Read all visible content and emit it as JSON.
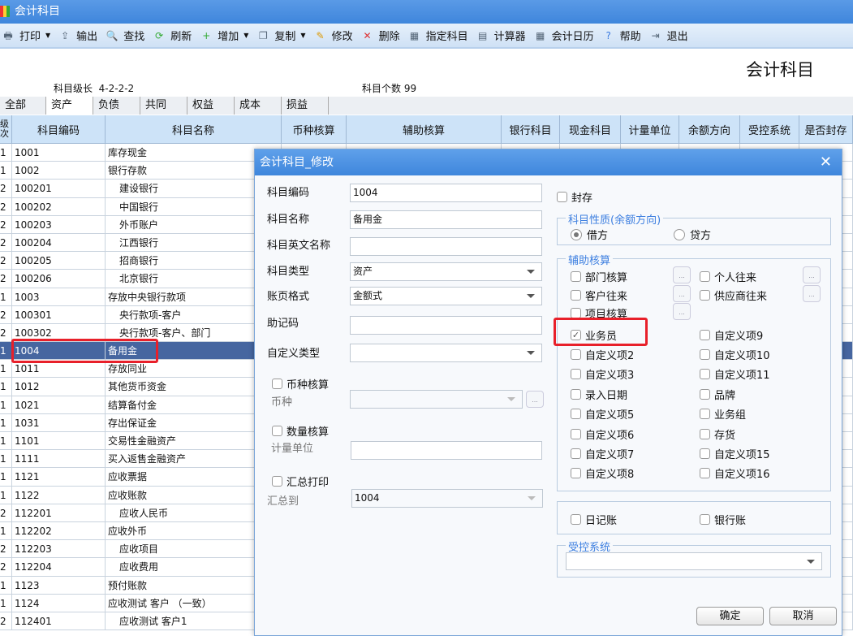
{
  "window": {
    "title": "会计科目"
  },
  "toolbar": [
    {
      "label": "打印",
      "icon": "printer-icon",
      "dropdown": true
    },
    {
      "label": "输出",
      "icon": "export-icon"
    },
    {
      "label": "查找",
      "icon": "search-icon"
    },
    {
      "label": "刷新",
      "icon": "refresh-icon"
    },
    {
      "label": "增加",
      "icon": "add-icon",
      "dropdown": true
    },
    {
      "label": "复制",
      "icon": "copy-icon",
      "dropdown": true
    },
    {
      "label": "修改",
      "icon": "edit-icon"
    },
    {
      "label": "删除",
      "icon": "delete-icon"
    },
    {
      "label": "指定科目",
      "icon": "assign-icon"
    },
    {
      "label": "计算器",
      "icon": "calculator-icon"
    },
    {
      "label": "会计日历",
      "icon": "calendar-icon"
    },
    {
      "label": "帮助",
      "icon": "help-icon"
    },
    {
      "label": "退出",
      "icon": "exit-icon"
    }
  ],
  "page": {
    "title": "会计科目",
    "level_label": "科目级长",
    "level_value": "4-2-2-2",
    "count_label": "科目个数",
    "count_value": "99"
  },
  "tabs": [
    "全部",
    "资产",
    "负债",
    "共同",
    "权益",
    "成本",
    "损益"
  ],
  "active_tab": "资产",
  "grid": {
    "columns": [
      "级次",
      "科目编码",
      "科目名称",
      "币种核算",
      "辅助核算",
      "银行科目",
      "现金科目",
      "计量单位",
      "余额方向",
      "受控系统",
      "是否封存"
    ],
    "rows": [
      [
        "1",
        "1001",
        "库存现金"
      ],
      [
        "1",
        "1002",
        "银行存款"
      ],
      [
        "2",
        "100201",
        "建设银行"
      ],
      [
        "2",
        "100202",
        "中国银行"
      ],
      [
        "2",
        "100203",
        "外币账户"
      ],
      [
        "2",
        "100204",
        "江西银行"
      ],
      [
        "2",
        "100205",
        "招商银行"
      ],
      [
        "2",
        "100206",
        "北京银行"
      ],
      [
        "1",
        "1003",
        "存放中央银行款项"
      ],
      [
        "2",
        "100301",
        "央行款项-客户"
      ],
      [
        "2",
        "100302",
        "央行款项-客户、部门"
      ],
      [
        "1",
        "1004",
        "备用金"
      ],
      [
        "1",
        "1011",
        "存放同业"
      ],
      [
        "1",
        "1012",
        "其他货币资金"
      ],
      [
        "1",
        "1021",
        "结算备付金"
      ],
      [
        "1",
        "1031",
        "存出保证金"
      ],
      [
        "1",
        "1101",
        "交易性金融资产"
      ],
      [
        "1",
        "1111",
        "买入返售金融资产"
      ],
      [
        "1",
        "1121",
        "应收票据"
      ],
      [
        "1",
        "1122",
        "应收账款"
      ],
      [
        "2",
        "112201",
        "应收人民币"
      ],
      [
        "1",
        "112202",
        "应收外币"
      ],
      [
        "2",
        "112203",
        "应收项目"
      ],
      [
        "2",
        "112204",
        "应收费用"
      ],
      [
        "1",
        "1123",
        "预付账款"
      ],
      [
        "1",
        "1124",
        "应收测试 客户 （一致）"
      ],
      [
        "2",
        "112401",
        "应收测试 客户1"
      ]
    ],
    "selected_code": "1004"
  },
  "dialog": {
    "title": "会计科目_修改",
    "fields": {
      "code": {
        "label": "科目编码",
        "value": "1004"
      },
      "name": {
        "label": "科目名称",
        "value": "备用金"
      },
      "english_name": {
        "label": "科目英文名称",
        "value": ""
      },
      "type": {
        "label": "科目类型",
        "value": "资产"
      },
      "ledger_format": {
        "label": "账页格式",
        "value": "金额式"
      },
      "mnemonic": {
        "label": "助记码",
        "value": ""
      },
      "custom_type": {
        "label": "自定义类型",
        "value": ""
      },
      "currency_acc": {
        "label": "币种核算",
        "checked": false
      },
      "currency": {
        "label": "币种",
        "value": ""
      },
      "qty_acc": {
        "label": "数量核算",
        "checked": false
      },
      "unit": {
        "label": "计量单位",
        "value": ""
      },
      "summary_print": {
        "label": "汇总打印",
        "checked": false
      },
      "summary_to": {
        "label": "汇总到",
        "value": "1004"
      }
    },
    "sealed": {
      "label": "封存",
      "checked": false
    },
    "nature": {
      "legend": "科目性质(余额方向)",
      "debit": "借方",
      "credit": "贷方",
      "selected": "借方"
    },
    "aux": {
      "legend": "辅助核算",
      "left": [
        {
          "label": "部门核算",
          "checked": false
        },
        {
          "label": "客户往来",
          "checked": false
        },
        {
          "label": "项目核算",
          "checked": false
        },
        {
          "label": "业务员",
          "checked": true
        },
        {
          "label": "自定义项2",
          "checked": false
        },
        {
          "label": "自定义项3",
          "checked": false
        },
        {
          "label": "录入日期",
          "checked": false
        },
        {
          "label": "自定义项5",
          "checked": false
        },
        {
          "label": "自定义项6",
          "checked": false
        },
        {
          "label": "自定义项7",
          "checked": false
        },
        {
          "label": "自定义项8",
          "checked": false
        }
      ],
      "right": [
        {
          "label": "个人往来",
          "checked": false
        },
        {
          "label": "供应商往来",
          "checked": false
        },
        {
          "label": "自定义项9",
          "checked": false
        },
        {
          "label": "自定义项10",
          "checked": false
        },
        {
          "label": "自定义项11",
          "checked": false
        },
        {
          "label": "品牌",
          "checked": false
        },
        {
          "label": "业务组",
          "checked": false
        },
        {
          "label": "存货",
          "checked": false
        },
        {
          "label": "自定义项15",
          "checked": false
        },
        {
          "label": "自定义项16",
          "checked": false
        }
      ]
    },
    "journal": {
      "label": "日记账",
      "checked": false
    },
    "bank_book": {
      "label": "银行账",
      "checked": false
    },
    "controlled": {
      "legend": "受控系统",
      "value": ""
    },
    "ok": "确定",
    "cancel": "取消"
  },
  "highlight_color": "#e8202a",
  "selection_color": "#4666a0"
}
